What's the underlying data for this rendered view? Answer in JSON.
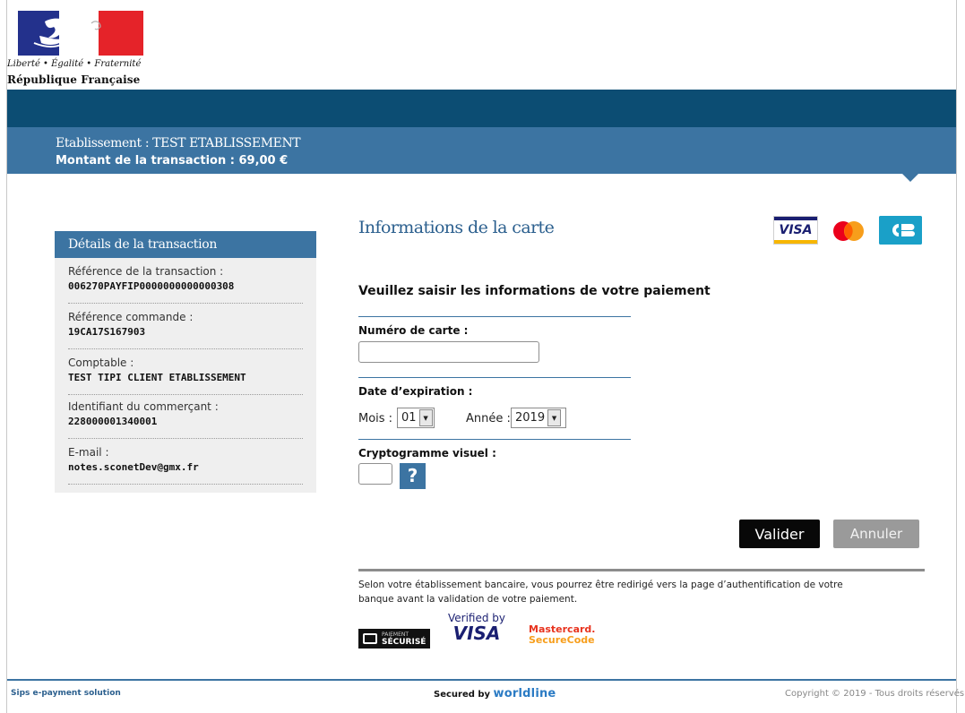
{
  "header": {
    "motto": "Liberté • Égalité • Fraternité",
    "republic": "République Française",
    "establishment": "Etablissement : TEST ETABLISSEMENT",
    "amount": "Montant de la transaction :  69,00 €"
  },
  "details": {
    "title": "Détails de la transaction",
    "items": [
      {
        "label": "Référence de la transaction :",
        "value": "006270PAYFIP0000000000000308"
      },
      {
        "label": "Référence commande :",
        "value": "19CA17S167903"
      },
      {
        "label": "Comptable :",
        "value": "TEST TIPI CLIENT ETABLISSEMENT"
      },
      {
        "label": "Identifiant du commerçant :",
        "value": "228000001340001"
      },
      {
        "label": "E-mail :",
        "value": "notes.sconetDev@gmx.fr"
      }
    ]
  },
  "form": {
    "title": "Informations de la carte",
    "intro": "Veuillez saisir les informations de votre paiement",
    "card_number_label": "Numéro de carte :",
    "card_number_value": "",
    "expiry_label": "Date d’expiration :",
    "month_label": "Mois :",
    "month_value": "01",
    "year_label": "Année :",
    "year_value": "2019",
    "cvv_label": "Cryptogramme visuel :",
    "cvv_value": "",
    "help_label": "?",
    "submit_label": "Valider",
    "cancel_label": "Annuler",
    "redirect_note": "Selon votre établissement bancaire, vous pourrez être redirigé vers la page d’authentification de votre banque avant la validation de votre paiement."
  },
  "card_logos": {
    "visa": "VISA",
    "cb_color": "#1aa0c8"
  },
  "security_logos": {
    "secure_top": "PAIEMENT",
    "secure_main": "SÉCURISÉ",
    "verified_by": "Verified by",
    "verified_brand": "VISA",
    "mc_line1": "Mastercard.",
    "mc_line2": "SecureCode"
  },
  "footer": {
    "left": "Sips e-payment solution",
    "secured_by": "Secured by",
    "brand": "worldline",
    "copyright": "Copyright © 2019 - Tous droits réservés"
  },
  "colors": {
    "dark_band": "#0c4d73",
    "blue_band": "#3c74a2",
    "title_blue": "#2b5f8e"
  }
}
